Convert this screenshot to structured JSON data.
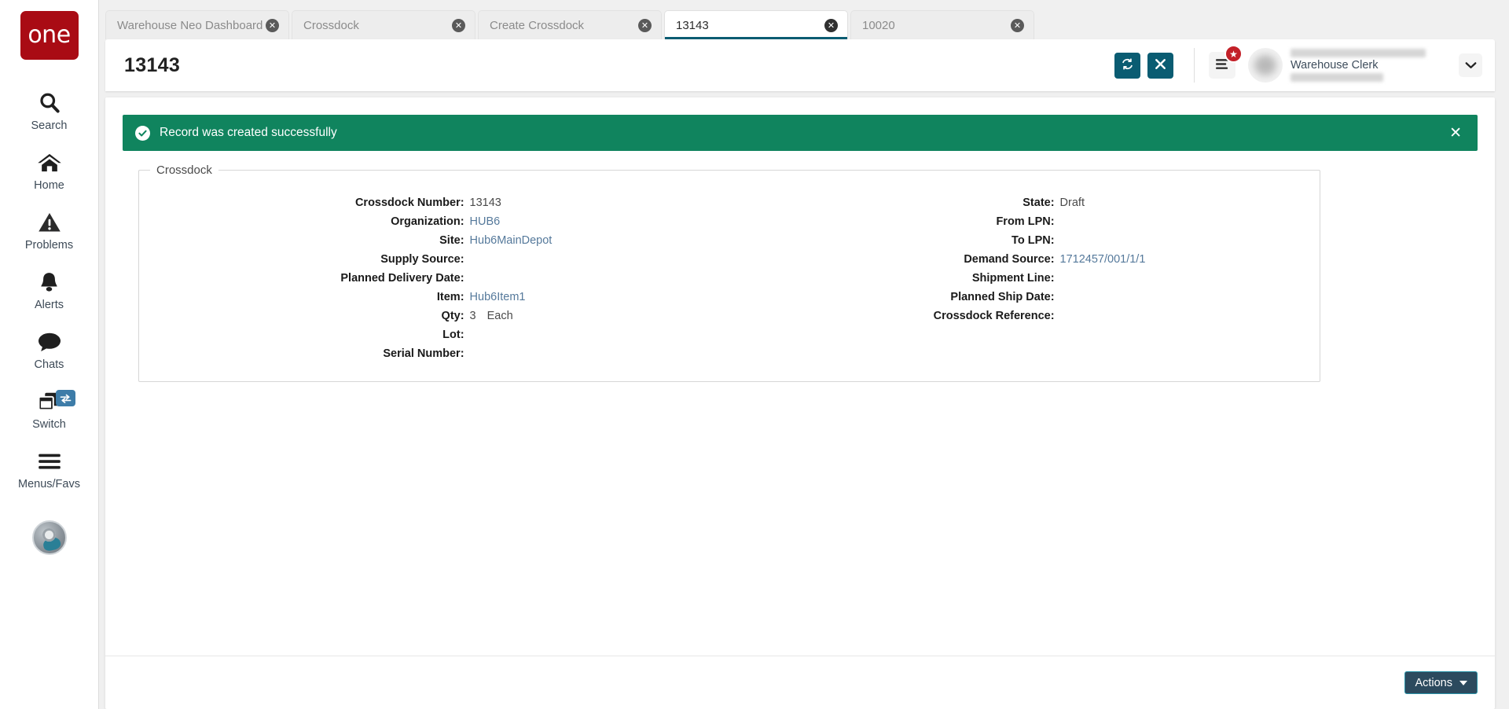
{
  "sidebar": {
    "logo_text": "one",
    "items": [
      {
        "label": "Search",
        "icon": "search-icon"
      },
      {
        "label": "Home",
        "icon": "home-icon"
      },
      {
        "label": "Problems",
        "icon": "warning-triangle-icon"
      },
      {
        "label": "Alerts",
        "icon": "bell-icon"
      },
      {
        "label": "Chats",
        "icon": "chat-bubble-icon"
      },
      {
        "label": "Switch",
        "icon": "windows-stack-icon"
      },
      {
        "label": "Menus/Favs",
        "icon": "hamburger-icon"
      }
    ]
  },
  "tabs": [
    {
      "label": "Warehouse Neo Dashboard",
      "active": false
    },
    {
      "label": "Crossdock",
      "active": false
    },
    {
      "label": "Create Crossdock",
      "active": false
    },
    {
      "label": "13143",
      "active": true
    },
    {
      "label": "10020",
      "active": false
    }
  ],
  "header": {
    "title": "13143",
    "refresh_icon": "refresh-icon",
    "close_icon": "close-icon",
    "menu_icon": "hamburger-menu-icon",
    "badge_icon": "star-icon",
    "user_role": "Warehouse Clerk",
    "caret_icon": "chevron-down-icon"
  },
  "banner": {
    "message": "Record was created successfully",
    "icon": "check-circle-icon",
    "close": "✕",
    "color": "#10845e"
  },
  "form": {
    "legend": "Crossdock",
    "left_fields": [
      {
        "label": "Crossdock Number:",
        "value": "13143",
        "type": "plain"
      },
      {
        "label": "Organization:",
        "value": "HUB6",
        "type": "link"
      },
      {
        "label": "Site:",
        "value": "Hub6MainDepot",
        "type": "link"
      },
      {
        "label": "Supply Source:",
        "value": "",
        "type": "plain"
      },
      {
        "label": "Planned Delivery Date:",
        "value": "",
        "type": "plain"
      },
      {
        "label": "Item:",
        "value": "Hub6Item1",
        "type": "link"
      },
      {
        "label": "Qty:",
        "value": "3",
        "uom": "Each",
        "type": "plain"
      },
      {
        "label": "Lot:",
        "value": "",
        "type": "plain"
      },
      {
        "label": "Serial Number:",
        "value": "",
        "type": "plain"
      }
    ],
    "right_fields": [
      {
        "label": "State:",
        "value": "Draft",
        "type": "plain"
      },
      {
        "label": "From LPN:",
        "value": "",
        "type": "plain"
      },
      {
        "label": "To LPN:",
        "value": "",
        "type": "plain"
      },
      {
        "label": "Demand Source:",
        "value": "1712457/001/1/1",
        "type": "link"
      },
      {
        "label": "Shipment Line:",
        "value": "",
        "type": "plain"
      },
      {
        "label": "Planned Ship Date:",
        "value": "",
        "type": "plain"
      },
      {
        "label": "Crossdock Reference:",
        "value": "",
        "type": "plain"
      }
    ]
  },
  "footer": {
    "actions_label": "Actions"
  },
  "colors": {
    "brand_red": "#a90b14",
    "teal": "#0a5c72",
    "success_green": "#10845e",
    "actions_bg": "#2c4a5e",
    "link_blue": "#55799b"
  }
}
